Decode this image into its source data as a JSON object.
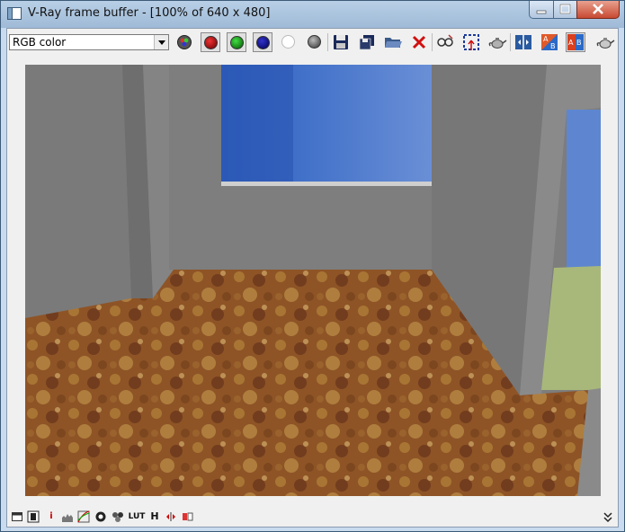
{
  "window": {
    "title": "V-Ray frame buffer - [100% of 640 x 480]"
  },
  "toolbar": {
    "channel_select": {
      "value": "RGB color"
    },
    "buttons": [
      {
        "name": "view-channel-icon"
      },
      {
        "name": "red-channel-icon",
        "color": "#8b0000"
      },
      {
        "name": "green-channel-icon",
        "color": "#007a00"
      },
      {
        "name": "blue-channel-icon",
        "color": "#00007a"
      },
      {
        "name": "alpha-channel-icon",
        "color": "#ffffff"
      },
      {
        "name": "mono-icon",
        "color": "#555555"
      },
      {
        "name": "save-icon"
      },
      {
        "name": "save-all-icon"
      },
      {
        "name": "open-icon"
      },
      {
        "name": "clear-icon"
      },
      {
        "name": "track-mouse-icon"
      },
      {
        "name": "region-icon"
      },
      {
        "name": "render-icon"
      },
      {
        "name": "compare-icon"
      },
      {
        "name": "ab-horizontal-icon"
      },
      {
        "name": "ab-vertical-icon"
      },
      {
        "name": "teapot-icon"
      }
    ]
  },
  "statusbar": {
    "buttons": [
      {
        "name": "panel-icon"
      },
      {
        "name": "film-icon"
      },
      {
        "name": "info-icon",
        "glyph": "i"
      },
      {
        "name": "levels-icon"
      },
      {
        "name": "curve-icon"
      },
      {
        "name": "exposure-icon"
      },
      {
        "name": "color-corrections-icon"
      },
      {
        "name": "lut-icon",
        "glyph": "LUT"
      },
      {
        "name": "histogram-icon",
        "glyph": "H"
      },
      {
        "name": "compare-strip-icon"
      },
      {
        "name": "ocio-icon"
      }
    ],
    "expand": {
      "name": "chevron-down-icon"
    }
  },
  "colors": {
    "wall": "#7f7f7f",
    "sky": "#3f6fc8",
    "floor": "#9a5a2a",
    "door_panel": "#a8b87a"
  }
}
